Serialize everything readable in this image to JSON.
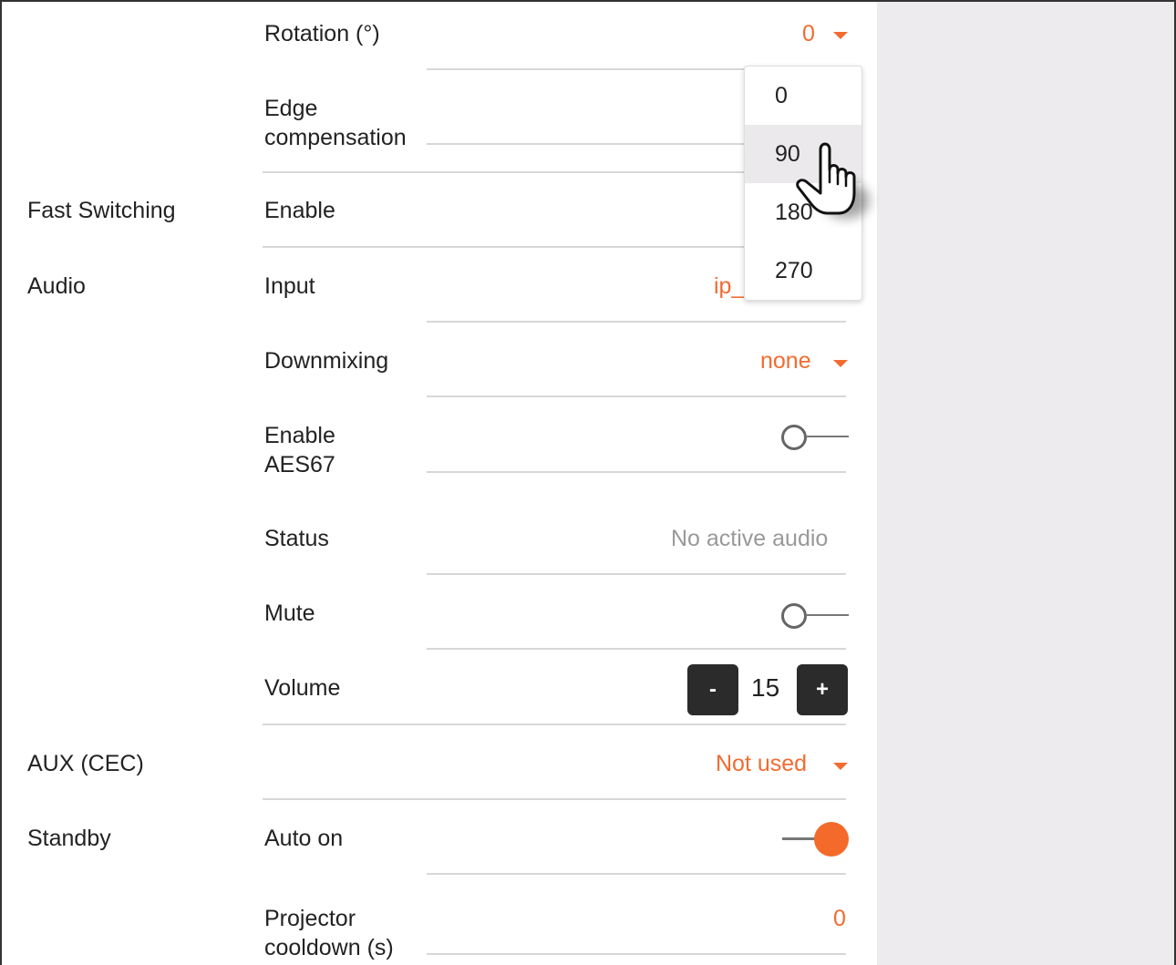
{
  "accent_color": "#f26b30",
  "video": {
    "rotation_label": "Rotation (°)",
    "rotation_value": "0",
    "edge_compensation_label": "Edge\ncompensation"
  },
  "rotation_menu": {
    "options": [
      "0",
      "90",
      "180",
      "270"
    ],
    "hovered": "90"
  },
  "fast_switching": {
    "section_label": "Fast Switching",
    "enable_label": "Enable"
  },
  "audio": {
    "section_label": "Audio",
    "input_label": "Input",
    "input_value": "ip_",
    "downmixing_label": "Downmixing",
    "downmixing_value": "none",
    "aes67_label": "Enable\nAES67",
    "aes67_enabled": false,
    "status_label": "Status",
    "status_value": "No active audio",
    "mute_label": "Mute",
    "mute_enabled": false,
    "volume_label": "Volume",
    "volume_value": "15",
    "volume_minus": "-",
    "volume_plus": "+"
  },
  "aux": {
    "section_label": "AUX (CEC)",
    "value": "Not used"
  },
  "standby": {
    "section_label": "Standby",
    "auto_on_label": "Auto on",
    "auto_on_enabled": true,
    "projector_cooldown_label": "Projector\ncooldown (s)",
    "projector_cooldown_value": "0"
  },
  "icons": {
    "dropdown_caret": "caret-down-icon",
    "cursor": "hand-pointer-icon"
  }
}
